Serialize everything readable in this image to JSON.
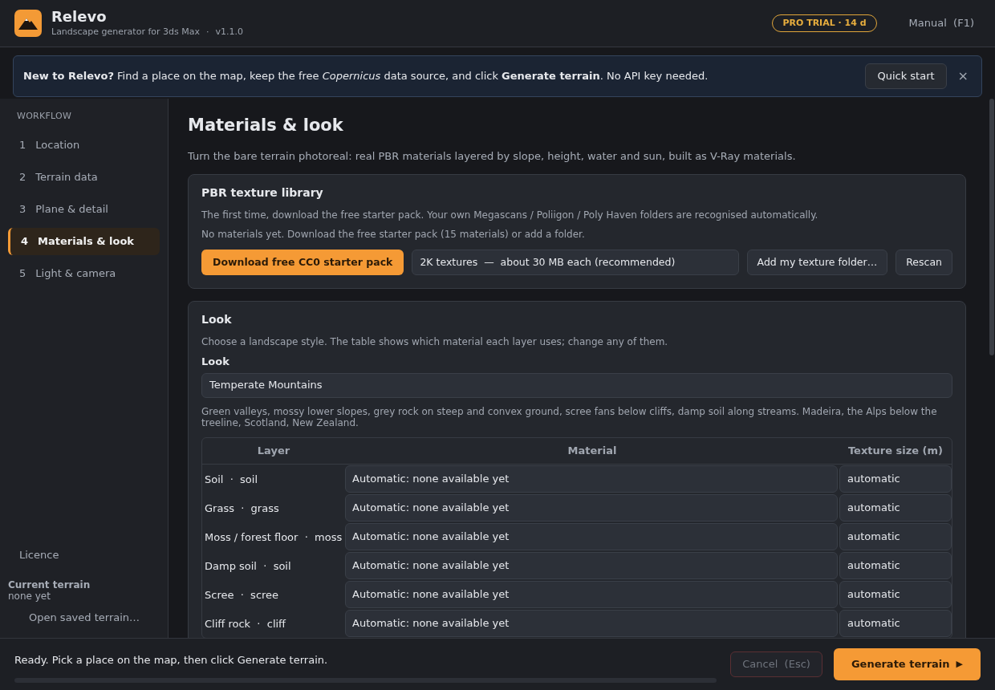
{
  "header": {
    "title": "Relevo",
    "subtitle": "Landscape generator for 3ds Max",
    "separator": "·",
    "version": "v1.1.0",
    "badge": "PRO TRIAL · 14 d",
    "manual_link": "Manual  (F1)"
  },
  "banner": {
    "text": "**New to Relevo?** Find a place on the map, keep the free *Copernicus* data source, and click **Generate terrain**. No API key needed.",
    "button": "Quick start",
    "close": "×"
  },
  "sidebar": {
    "heading": "WORKFLOW",
    "items": [
      {
        "number": "1",
        "label": "Location",
        "selected": false
      },
      {
        "number": "2",
        "label": "Terrain data",
        "selected": false
      },
      {
        "number": "3",
        "label": "Plane & detail",
        "selected": false
      },
      {
        "number": "4",
        "label": "Materials & look",
        "selected": true
      },
      {
        "number": "5",
        "label": "Light & camera",
        "selected": false
      }
    ],
    "licence": "Licence",
    "current_terrain_label": "Current terrain",
    "current_terrain_value": "none yet",
    "open_saved": "Open saved terrain…"
  },
  "page": {
    "title": "Materials & look",
    "intro": "Turn the bare terrain photoreal: real PBR materials layered by slope, height, water and sun, built as V-Ray materials.",
    "library": {
      "title": "PBR texture library",
      "note1": "The first time, download the free starter pack. Your own Megascans / Poliigon / Poly Haven folders are recognised automatically.",
      "note2": "No materials yet. Download the free starter pack (15 materials) or add a folder.",
      "download_button": "Download free CC0 starter pack",
      "resolution": "2K textures  —  about 30 MB each (recommended)",
      "add_folder_button": "Add my texture folder…",
      "rescan_button": "Rescan"
    },
    "look": {
      "title": "Look",
      "hint": "Choose a landscape style. The table shows which material each layer uses; change any of them.",
      "field_label": "Look",
      "value": "Temperate Mountains",
      "description": "Green valleys, mossy lower slopes, grey rock on steep and convex ground, scree fans below cliffs, damp soil along streams. Madeira, the Alps below the treeline, Scotland, New Zealand.",
      "table": {
        "columns": [
          "Layer",
          "Material",
          "Texture size (m)"
        ],
        "rows": [
          {
            "layer": "Soil  ·  soil",
            "material": "Automatic: none available yet",
            "size": "automatic"
          },
          {
            "layer": "Grass  ·  grass",
            "material": "Automatic: none available yet",
            "size": "automatic"
          },
          {
            "layer": "Moss / forest floor  ·  moss",
            "material": "Automatic: none available yet",
            "size": "automatic"
          },
          {
            "layer": "Damp soil  ·  soil",
            "material": "Automatic: none available yet",
            "size": "automatic"
          },
          {
            "layer": "Scree  ·  scree",
            "material": "Automatic: none available yet",
            "size": "automatic"
          },
          {
            "layer": "Cliff rock  ·  cliff",
            "material": "Automatic: none available yet",
            "size": "automatic"
          }
        ]
      }
    }
  },
  "footer": {
    "status": "Ready. Pick a place on the map, then click Generate terrain.",
    "progress": {
      "level": 0
    },
    "cancel_button": {
      "label": "Cancel  (Esc)",
      "disabled": true
    },
    "generate_button": "Generate terrain",
    "generate_icon": "▶"
  }
}
